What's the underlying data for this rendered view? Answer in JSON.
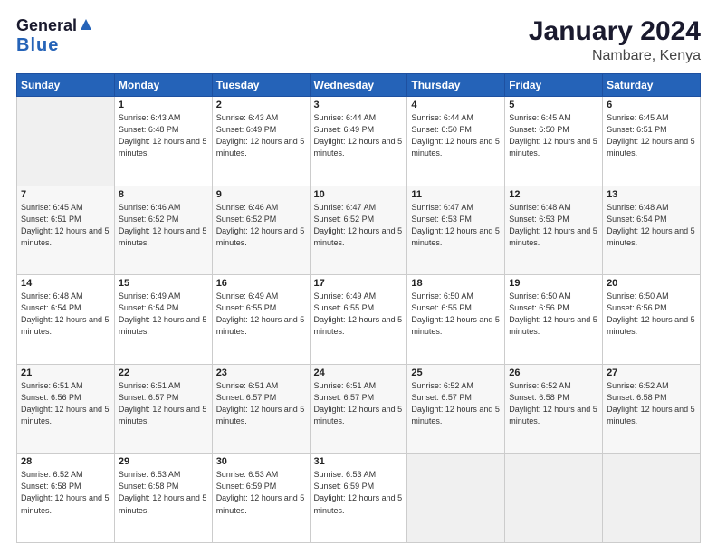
{
  "logo": {
    "line1": "General",
    "line2": "Blue"
  },
  "header": {
    "title": "January 2024",
    "subtitle": "Nambare, Kenya"
  },
  "weekdays": [
    "Sunday",
    "Monday",
    "Tuesday",
    "Wednesday",
    "Thursday",
    "Friday",
    "Saturday"
  ],
  "weeks": [
    [
      {
        "day": "",
        "sunrise": "",
        "sunset": "",
        "daylight": ""
      },
      {
        "day": "1",
        "sunrise": "Sunrise: 6:43 AM",
        "sunset": "Sunset: 6:48 PM",
        "daylight": "Daylight: 12 hours and 5 minutes."
      },
      {
        "day": "2",
        "sunrise": "Sunrise: 6:43 AM",
        "sunset": "Sunset: 6:49 PM",
        "daylight": "Daylight: 12 hours and 5 minutes."
      },
      {
        "day": "3",
        "sunrise": "Sunrise: 6:44 AM",
        "sunset": "Sunset: 6:49 PM",
        "daylight": "Daylight: 12 hours and 5 minutes."
      },
      {
        "day": "4",
        "sunrise": "Sunrise: 6:44 AM",
        "sunset": "Sunset: 6:50 PM",
        "daylight": "Daylight: 12 hours and 5 minutes."
      },
      {
        "day": "5",
        "sunrise": "Sunrise: 6:45 AM",
        "sunset": "Sunset: 6:50 PM",
        "daylight": "Daylight: 12 hours and 5 minutes."
      },
      {
        "day": "6",
        "sunrise": "Sunrise: 6:45 AM",
        "sunset": "Sunset: 6:51 PM",
        "daylight": "Daylight: 12 hours and 5 minutes."
      }
    ],
    [
      {
        "day": "7",
        "sunrise": "Sunrise: 6:45 AM",
        "sunset": "Sunset: 6:51 PM",
        "daylight": "Daylight: 12 hours and 5 minutes."
      },
      {
        "day": "8",
        "sunrise": "Sunrise: 6:46 AM",
        "sunset": "Sunset: 6:52 PM",
        "daylight": "Daylight: 12 hours and 5 minutes."
      },
      {
        "day": "9",
        "sunrise": "Sunrise: 6:46 AM",
        "sunset": "Sunset: 6:52 PM",
        "daylight": "Daylight: 12 hours and 5 minutes."
      },
      {
        "day": "10",
        "sunrise": "Sunrise: 6:47 AM",
        "sunset": "Sunset: 6:52 PM",
        "daylight": "Daylight: 12 hours and 5 minutes."
      },
      {
        "day": "11",
        "sunrise": "Sunrise: 6:47 AM",
        "sunset": "Sunset: 6:53 PM",
        "daylight": "Daylight: 12 hours and 5 minutes."
      },
      {
        "day": "12",
        "sunrise": "Sunrise: 6:48 AM",
        "sunset": "Sunset: 6:53 PM",
        "daylight": "Daylight: 12 hours and 5 minutes."
      },
      {
        "day": "13",
        "sunrise": "Sunrise: 6:48 AM",
        "sunset": "Sunset: 6:54 PM",
        "daylight": "Daylight: 12 hours and 5 minutes."
      }
    ],
    [
      {
        "day": "14",
        "sunrise": "Sunrise: 6:48 AM",
        "sunset": "Sunset: 6:54 PM",
        "daylight": "Daylight: 12 hours and 5 minutes."
      },
      {
        "day": "15",
        "sunrise": "Sunrise: 6:49 AM",
        "sunset": "Sunset: 6:54 PM",
        "daylight": "Daylight: 12 hours and 5 minutes."
      },
      {
        "day": "16",
        "sunrise": "Sunrise: 6:49 AM",
        "sunset": "Sunset: 6:55 PM",
        "daylight": "Daylight: 12 hours and 5 minutes."
      },
      {
        "day": "17",
        "sunrise": "Sunrise: 6:49 AM",
        "sunset": "Sunset: 6:55 PM",
        "daylight": "Daylight: 12 hours and 5 minutes."
      },
      {
        "day": "18",
        "sunrise": "Sunrise: 6:50 AM",
        "sunset": "Sunset: 6:55 PM",
        "daylight": "Daylight: 12 hours and 5 minutes."
      },
      {
        "day": "19",
        "sunrise": "Sunrise: 6:50 AM",
        "sunset": "Sunset: 6:56 PM",
        "daylight": "Daylight: 12 hours and 5 minutes."
      },
      {
        "day": "20",
        "sunrise": "Sunrise: 6:50 AM",
        "sunset": "Sunset: 6:56 PM",
        "daylight": "Daylight: 12 hours and 5 minutes."
      }
    ],
    [
      {
        "day": "21",
        "sunrise": "Sunrise: 6:51 AM",
        "sunset": "Sunset: 6:56 PM",
        "daylight": "Daylight: 12 hours and 5 minutes."
      },
      {
        "day": "22",
        "sunrise": "Sunrise: 6:51 AM",
        "sunset": "Sunset: 6:57 PM",
        "daylight": "Daylight: 12 hours and 5 minutes."
      },
      {
        "day": "23",
        "sunrise": "Sunrise: 6:51 AM",
        "sunset": "Sunset: 6:57 PM",
        "daylight": "Daylight: 12 hours and 5 minutes."
      },
      {
        "day": "24",
        "sunrise": "Sunrise: 6:51 AM",
        "sunset": "Sunset: 6:57 PM",
        "daylight": "Daylight: 12 hours and 5 minutes."
      },
      {
        "day": "25",
        "sunrise": "Sunrise: 6:52 AM",
        "sunset": "Sunset: 6:57 PM",
        "daylight": "Daylight: 12 hours and 5 minutes."
      },
      {
        "day": "26",
        "sunrise": "Sunrise: 6:52 AM",
        "sunset": "Sunset: 6:58 PM",
        "daylight": "Daylight: 12 hours and 5 minutes."
      },
      {
        "day": "27",
        "sunrise": "Sunrise: 6:52 AM",
        "sunset": "Sunset: 6:58 PM",
        "daylight": "Daylight: 12 hours and 5 minutes."
      }
    ],
    [
      {
        "day": "28",
        "sunrise": "Sunrise: 6:52 AM",
        "sunset": "Sunset: 6:58 PM",
        "daylight": "Daylight: 12 hours and 5 minutes."
      },
      {
        "day": "29",
        "sunrise": "Sunrise: 6:53 AM",
        "sunset": "Sunset: 6:58 PM",
        "daylight": "Daylight: 12 hours and 5 minutes."
      },
      {
        "day": "30",
        "sunrise": "Sunrise: 6:53 AM",
        "sunset": "Sunset: 6:59 PM",
        "daylight": "Daylight: 12 hours and 5 minutes."
      },
      {
        "day": "31",
        "sunrise": "Sunrise: 6:53 AM",
        "sunset": "Sunset: 6:59 PM",
        "daylight": "Daylight: 12 hours and 5 minutes."
      },
      {
        "day": "",
        "sunrise": "",
        "sunset": "",
        "daylight": ""
      },
      {
        "day": "",
        "sunrise": "",
        "sunset": "",
        "daylight": ""
      },
      {
        "day": "",
        "sunrise": "",
        "sunset": "",
        "daylight": ""
      }
    ]
  ]
}
